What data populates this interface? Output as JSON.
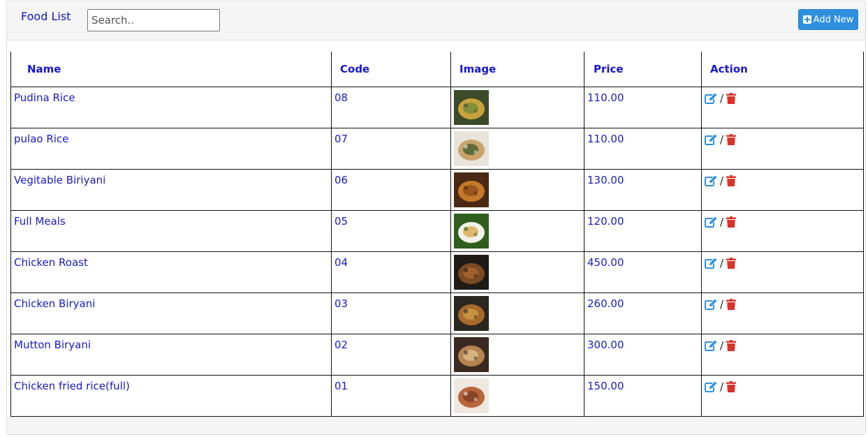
{
  "header": {
    "title": "Food List",
    "search_placeholder": "Search..",
    "add_button_label": "Add New"
  },
  "table": {
    "columns": [
      "Name",
      "Code",
      "Image",
      "Price",
      "Action"
    ],
    "action_separator": "/",
    "rows": [
      {
        "name": "Pudina Rice",
        "code": "08",
        "price": "110.00",
        "image_colors": [
          "#3c4a2a",
          "#c9a23e",
          "#6b8a3a"
        ]
      },
      {
        "name": "pulao Rice",
        "code": "07",
        "price": "110.00",
        "image_colors": [
          "#e8e4dc",
          "#c9a36a",
          "#3a5a2a"
        ]
      },
      {
        "name": "Vegitable Biriyani",
        "code": "06",
        "price": "130.00",
        "image_colors": [
          "#4a2a15",
          "#c47a2a",
          "#8a4a1a"
        ]
      },
      {
        "name": "Full Meals",
        "code": "05",
        "price": "120.00",
        "image_colors": [
          "#2f5e1e",
          "#f2f0ea",
          "#d9a441"
        ]
      },
      {
        "name": "Chicken Roast",
        "code": "04",
        "price": "450.00",
        "image_colors": [
          "#1e1a16",
          "#7a4a22",
          "#b06a30"
        ]
      },
      {
        "name": "Chicken Biryani",
        "code": "03",
        "price": "260.00",
        "image_colors": [
          "#2a2620",
          "#a86a2a",
          "#d0a04a"
        ]
      },
      {
        "name": "Mutton Biryani",
        "code": "02",
        "price": "300.00",
        "image_colors": [
          "#3a2a22",
          "#b58450",
          "#e0c08a"
        ]
      },
      {
        "name": "Chicken fried rice(full)",
        "code": "01",
        "price": "150.00",
        "image_colors": [
          "#efe8e0",
          "#b8653a",
          "#7a3a22"
        ]
      }
    ]
  },
  "colors": {
    "accent": "#2f8fdf",
    "text_blue": "#1a1acb",
    "edit_icon": "#2f8fdf",
    "delete_icon": "#d9342b",
    "header_bg": "#f5f5f5"
  }
}
